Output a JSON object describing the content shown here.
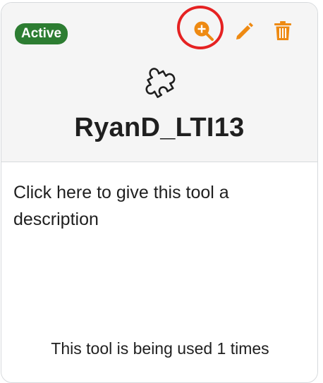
{
  "card": {
    "status": "Active",
    "tool_name": "RyanD_LTI13",
    "description": "Click here to give this tool a description",
    "usage": "This tool is being used 1 times"
  },
  "icons": {
    "zoom": "zoom-in-icon",
    "edit": "pencil-icon",
    "delete": "trash-icon",
    "tool": "puzzle-piece-icon"
  },
  "colors": {
    "accent": "#ee8a12",
    "status": "#2d7d32",
    "highlight": "#e52222"
  }
}
